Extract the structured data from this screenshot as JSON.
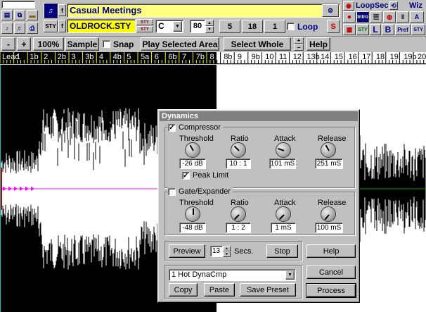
{
  "header": {
    "song_title": "Casual Meetings",
    "style_file": "OLDROCK.STY",
    "key": "C",
    "tempo": "80",
    "field_5": "5",
    "field_18": "18",
    "field_1": "1",
    "loop_label": "Loop",
    "s_label": "S",
    "f_label": "f",
    "sty_label": "STY",
    "loopsec_label": "LoopSec",
    "wiz_label": "Wiz",
    "intro_label": "Intro",
    "l_label": "L",
    "b_label": "B",
    "pref_label": "Pref",
    "sty2_label": "STY"
  },
  "toolbar": {
    "minus": "-",
    "plus": "+",
    "zoom": "100%",
    "sample": "Sample",
    "snap": "Snap",
    "play_selected": "Play Selected Area",
    "select_whole": "Select Whole",
    "help": "Help"
  },
  "ruler": {
    "labels": [
      "Lead",
      "1",
      "1b",
      "2",
      "2b",
      "3",
      "3b",
      "4",
      "4b",
      "5",
      "5a",
      "6",
      "6b",
      "7",
      "7b",
      "8",
      "8b",
      "9",
      "9b",
      "10",
      "11",
      "12",
      "13b",
      "14",
      "15",
      "16",
      "17",
      "18",
      "19",
      "19b",
      "20"
    ]
  },
  "dialog": {
    "title": "Dynamics",
    "compressor": {
      "label": "Compressor",
      "checked": true,
      "threshold_label": "Threshold",
      "ratio_label": "Ratio",
      "attack_label": "Attack",
      "release_label": "Release",
      "threshold": "-26 dB",
      "ratio": "10 : 1",
      "attack": "101 mS",
      "release": "251 mS",
      "peak_limit": "Peak Limit",
      "peak_limit_checked": true
    },
    "gate": {
      "label": "Gate/Expander",
      "checked": false,
      "threshold_label": "Threshold",
      "ratio_label": "Ratio",
      "attack_label": "Attack",
      "release_label": "Release",
      "threshold": "-48 dB",
      "ratio": "1 : 2",
      "attack": "1 mS",
      "release": "100 mS"
    },
    "preview": "Preview",
    "secs_value": "13",
    "secs_label": "Secs.",
    "stop": "Stop",
    "help": "Help",
    "preset": "1 Hot DynaCmp",
    "cancel": "Cancel",
    "copy": "Copy",
    "paste": "Paste",
    "save_preset": "Save Preset",
    "process": "Process"
  },
  "colors": {
    "accent_blue": "#000080",
    "title_yellow": "#ffff80",
    "playhead_magenta": "#ff00ff",
    "waveform_green": "#00a000"
  }
}
